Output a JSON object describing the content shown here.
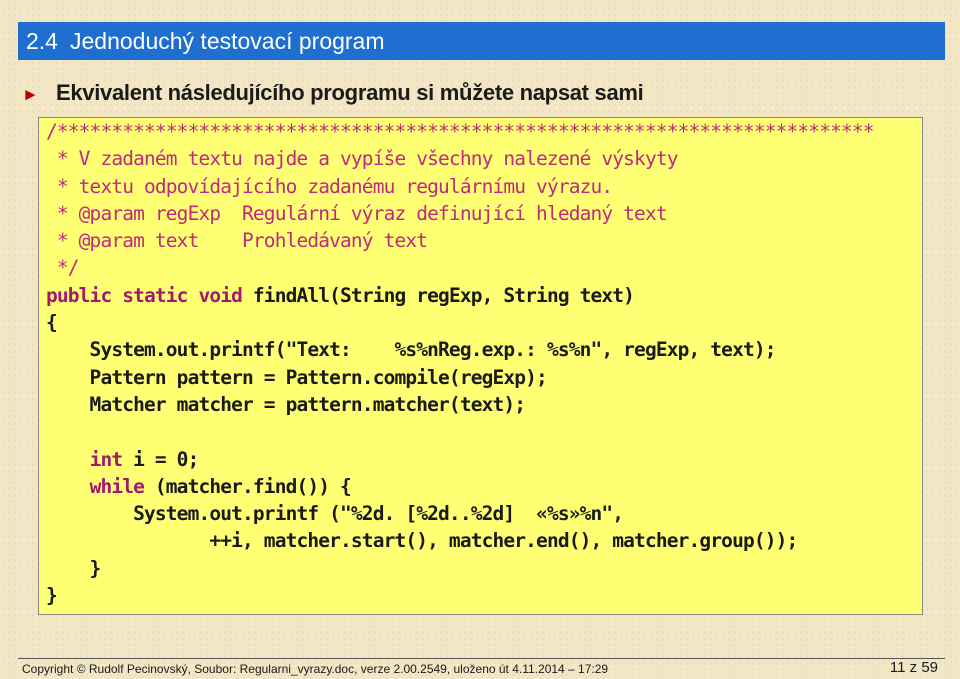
{
  "slide": {
    "section_number": "2.4",
    "title": "Jednoduchý testovací program",
    "bullet_text": "Ekvivalent následujícího programu si můžete napsat sami"
  },
  "code": {
    "comment_lines": [
      "/***************************************************************************",
      " * V zadaném textu najde a vypíše všechny nalezené výskyty",
      " * textu odpovídajícího zadanému regulárnímu výrazu.",
      " * @param regExp  Regulární výraz definující hledaný text",
      " * @param text    Prohledávaný text",
      " */"
    ],
    "signature_keywords": "public static void ",
    "signature_rest": "findAll(String regExp, String text)",
    "open_brace": "{",
    "line_printf": "    System.out.printf(\"Text:    %s%nReg.exp.: %s%n\", regExp, text);",
    "line_pattern": "    Pattern pattern = Pattern.compile(regExp);",
    "line_matcher": "    Matcher matcher = pattern.matcher(text);",
    "blank": "",
    "indent": "    ",
    "kw_int": "int",
    "int_rest": " i = 0;",
    "kw_while": "while",
    "while_rest": " (matcher.find()) {",
    "loop_printf": "        System.out.printf (\"%2d. [%2d..%2d]  «%s»%n\",",
    "loop_args": "               ++i, matcher.start(), matcher.end(), matcher.group());",
    "inner_close": "    }",
    "close_brace": "}"
  },
  "footer": {
    "copyright": "Copyright © Rudolf Pecinovský, Soubor: Regularni_vyrazy.doc, verze 2.00.2549, uloženo út 4.11.2014 – 17:29",
    "page": "11 z 59"
  }
}
